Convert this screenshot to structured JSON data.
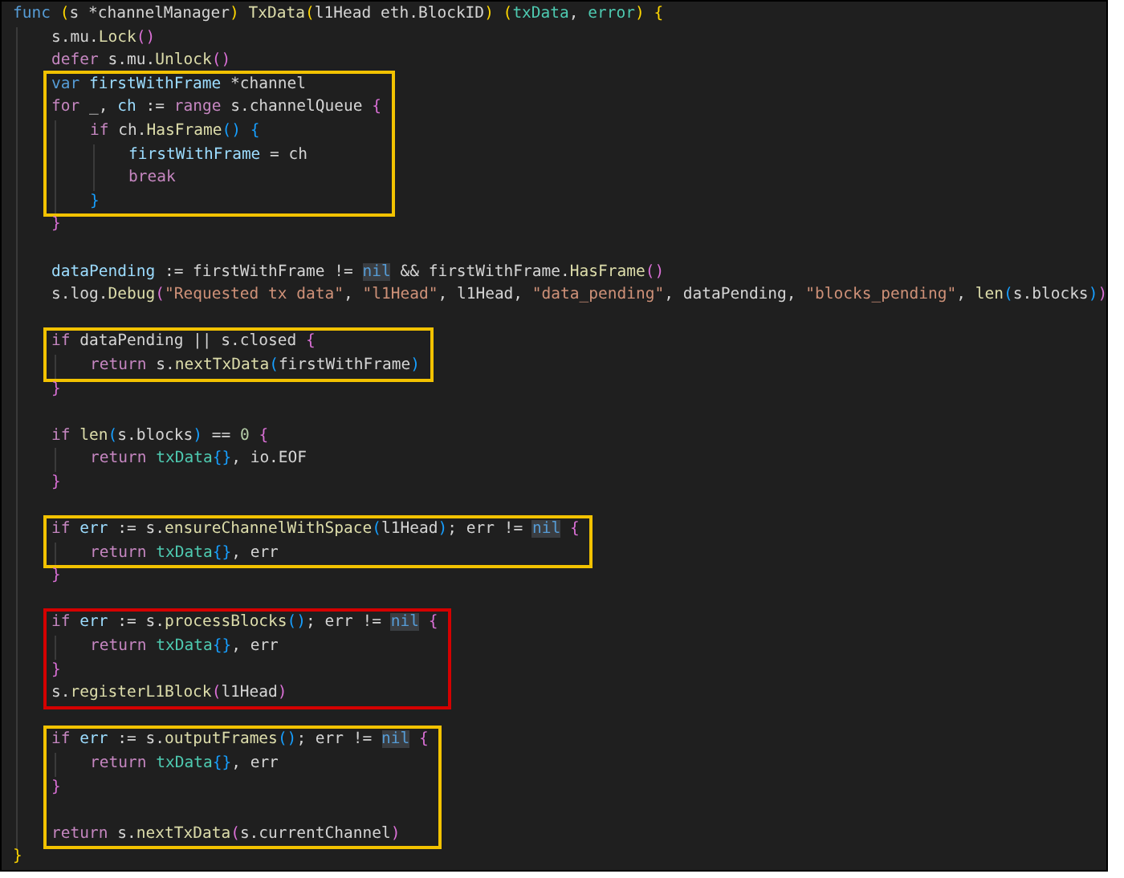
{
  "code": [
    {
      "kind": "line",
      "tokens": [
        {
          "kind": "kw",
          "text": "func "
        },
        {
          "kind": "b1",
          "text": "("
        },
        {
          "kind": "plain",
          "text": "s *channelManager"
        },
        {
          "kind": "b1",
          "text": ") "
        },
        {
          "kind": "fn",
          "text": "TxData"
        },
        {
          "kind": "b1",
          "text": "("
        },
        {
          "kind": "plain",
          "text": "l1Head eth.BlockID"
        },
        {
          "kind": "b1",
          "text": ") ("
        },
        {
          "kind": "type",
          "text": "txData"
        },
        {
          "kind": "plain",
          "text": ", "
        },
        {
          "kind": "type",
          "text": "error"
        },
        {
          "kind": "b1",
          "text": ") {"
        }
      ]
    },
    {
      "kind": "block",
      "children": [
        {
          "kind": "line",
          "tokens": [
            {
              "kind": "plain",
              "text": "s.mu."
            },
            {
              "kind": "fn",
              "text": "Lock"
            },
            {
              "kind": "b2",
              "text": "()"
            }
          ]
        },
        {
          "kind": "line",
          "tokens": [
            {
              "kind": "ctl",
              "text": "defer"
            },
            {
              "kind": "plain",
              "text": " s.mu."
            },
            {
              "kind": "fn",
              "text": "Unlock"
            },
            {
              "kind": "b2",
              "text": "()"
            }
          ]
        },
        {
          "kind": "box",
          "color": "#f2c200",
          "children": [
            {
              "kind": "line",
              "tokens": [
                {
                  "kind": "kw",
                  "text": "var "
                },
                {
                  "kind": "var",
                  "text": "firstWithFrame"
                },
                {
                  "kind": "plain",
                  "text": " *channel"
                }
              ]
            },
            {
              "kind": "line",
              "tokens": [
                {
                  "kind": "ctl",
                  "text": "for"
                },
                {
                  "kind": "plain",
                  "text": " _, "
                },
                {
                  "kind": "var",
                  "text": "ch"
                },
                {
                  "kind": "plain",
                  "text": " := "
                },
                {
                  "kind": "ctl",
                  "text": "range"
                },
                {
                  "kind": "plain",
                  "text": " s.channelQueue "
                },
                {
                  "kind": "b2",
                  "text": "{"
                }
              ]
            },
            {
              "kind": "block",
              "children": [
                {
                  "kind": "line",
                  "tokens": [
                    {
                      "kind": "ctl",
                      "text": "if"
                    },
                    {
                      "kind": "plain",
                      "text": " ch."
                    },
                    {
                      "kind": "fn",
                      "text": "HasFrame"
                    },
                    {
                      "kind": "b3",
                      "text": "() {"
                    }
                  ]
                },
                {
                  "kind": "block",
                  "children": [
                    {
                      "kind": "line",
                      "tokens": [
                        {
                          "kind": "var",
                          "text": "firstWithFrame"
                        },
                        {
                          "kind": "plain",
                          "text": " = ch"
                        }
                      ]
                    },
                    {
                      "kind": "line",
                      "tokens": [
                        {
                          "kind": "ctl",
                          "text": "break"
                        }
                      ]
                    }
                  ]
                },
                {
                  "kind": "line",
                  "tokens": [
                    {
                      "kind": "b3",
                      "text": "}"
                    }
                  ]
                }
              ]
            }
          ]
        },
        {
          "kind": "line",
          "tokens": [
            {
              "kind": "b2",
              "text": "}"
            }
          ]
        },
        {
          "kind": "blank"
        },
        {
          "kind": "line",
          "tokens": [
            {
              "kind": "var",
              "text": "dataPending"
            },
            {
              "kind": "plain",
              "text": " := firstWithFrame != "
            },
            {
              "kind": "nil",
              "text": "nil"
            },
            {
              "kind": "plain",
              "text": " && firstWithFrame."
            },
            {
              "kind": "fn",
              "text": "HasFrame"
            },
            {
              "kind": "b2",
              "text": "()"
            }
          ]
        },
        {
          "kind": "line",
          "tokens": [
            {
              "kind": "plain",
              "text": "s.log."
            },
            {
              "kind": "fn",
              "text": "Debug"
            },
            {
              "kind": "b2",
              "text": "("
            },
            {
              "kind": "str",
              "text": "\"Requested tx data\""
            },
            {
              "kind": "plain",
              "text": ", "
            },
            {
              "kind": "str",
              "text": "\"l1Head\""
            },
            {
              "kind": "plain",
              "text": ", l1Head, "
            },
            {
              "kind": "str",
              "text": "\"data_pending\""
            },
            {
              "kind": "plain",
              "text": ", dataPending, "
            },
            {
              "kind": "str",
              "text": "\"blocks_pending\""
            },
            {
              "kind": "plain",
              "text": ", "
            },
            {
              "kind": "fn",
              "text": "len"
            },
            {
              "kind": "b3",
              "text": "("
            },
            {
              "kind": "plain",
              "text": "s.blocks"
            },
            {
              "kind": "b3",
              "text": ")"
            },
            {
              "kind": "b2",
              "text": ")"
            }
          ]
        },
        {
          "kind": "blank"
        },
        {
          "kind": "box",
          "color": "#f2c200",
          "children": [
            {
              "kind": "line",
              "tokens": [
                {
                  "kind": "ctl",
                  "text": "if"
                },
                {
                  "kind": "plain",
                  "text": " dataPending || s.closed "
                },
                {
                  "kind": "b2",
                  "text": "{"
                }
              ]
            },
            {
              "kind": "block",
              "children": [
                {
                  "kind": "line",
                  "tokens": [
                    {
                      "kind": "ctl",
                      "text": "return"
                    },
                    {
                      "kind": "plain",
                      "text": " s."
                    },
                    {
                      "kind": "fn",
                      "text": "nextTxData"
                    },
                    {
                      "kind": "b3",
                      "text": "("
                    },
                    {
                      "kind": "plain",
                      "text": "firstWithFrame"
                    },
                    {
                      "kind": "b3",
                      "text": ")"
                    }
                  ]
                }
              ]
            }
          ]
        },
        {
          "kind": "line",
          "tokens": [
            {
              "kind": "b2",
              "text": "}"
            }
          ]
        },
        {
          "kind": "blank"
        },
        {
          "kind": "line",
          "tokens": [
            {
              "kind": "ctl",
              "text": "if "
            },
            {
              "kind": "fn",
              "text": "len"
            },
            {
              "kind": "b3",
              "text": "("
            },
            {
              "kind": "plain",
              "text": "s.blocks"
            },
            {
              "kind": "b3",
              "text": ")"
            },
            {
              "kind": "plain",
              "text": " == "
            },
            {
              "kind": "num",
              "text": "0 "
            },
            {
              "kind": "b2",
              "text": "{"
            }
          ]
        },
        {
          "kind": "block",
          "children": [
            {
              "kind": "line",
              "tokens": [
                {
                  "kind": "ctl",
                  "text": "return "
                },
                {
                  "kind": "type",
                  "text": "txData"
                },
                {
                  "kind": "b3",
                  "text": "{}"
                },
                {
                  "kind": "plain",
                  "text": ", io.EOF"
                }
              ]
            }
          ]
        },
        {
          "kind": "line",
          "tokens": [
            {
              "kind": "b2",
              "text": "}"
            }
          ]
        },
        {
          "kind": "blank"
        },
        {
          "kind": "box",
          "color": "#f2c200",
          "children": [
            {
              "kind": "line",
              "tokens": [
                {
                  "kind": "ctl",
                  "text": "if "
                },
                {
                  "kind": "var",
                  "text": "err"
                },
                {
                  "kind": "plain",
                  "text": " := s."
                },
                {
                  "kind": "fn",
                  "text": "ensureChannelWithSpace"
                },
                {
                  "kind": "b3",
                  "text": "("
                },
                {
                  "kind": "plain",
                  "text": "l1Head"
                },
                {
                  "kind": "b3",
                  "text": ")"
                },
                {
                  "kind": "plain",
                  "text": "; err != "
                },
                {
                  "kind": "nil",
                  "text": "nil"
                },
                {
                  "kind": "b2",
                  "text": " {"
                }
              ]
            },
            {
              "kind": "block",
              "children": [
                {
                  "kind": "line",
                  "tokens": [
                    {
                      "kind": "ctl",
                      "text": "return "
                    },
                    {
                      "kind": "type",
                      "text": "txData"
                    },
                    {
                      "kind": "b3",
                      "text": "{}"
                    },
                    {
                      "kind": "plain",
                      "text": ", err"
                    }
                  ]
                }
              ]
            }
          ]
        },
        {
          "kind": "line",
          "tokens": [
            {
              "kind": "b2",
              "text": "}"
            }
          ]
        },
        {
          "kind": "blank"
        },
        {
          "kind": "box",
          "color": "#d40000",
          "children": [
            {
              "kind": "line",
              "tokens": [
                {
                  "kind": "ctl",
                  "text": "if "
                },
                {
                  "kind": "var",
                  "text": "err"
                },
                {
                  "kind": "plain",
                  "text": " := s."
                },
                {
                  "kind": "fn",
                  "text": "processBlocks"
                },
                {
                  "kind": "b3",
                  "text": "()"
                },
                {
                  "kind": "plain",
                  "text": "; err != "
                },
                {
                  "kind": "nil",
                  "text": "nil"
                },
                {
                  "kind": "b2",
                  "text": " {"
                }
              ]
            },
            {
              "kind": "block",
              "children": [
                {
                  "kind": "line",
                  "tokens": [
                    {
                      "kind": "ctl",
                      "text": "return "
                    },
                    {
                      "kind": "type",
                      "text": "txData"
                    },
                    {
                      "kind": "b3",
                      "text": "{}"
                    },
                    {
                      "kind": "plain",
                      "text": ", err"
                    }
                  ]
                }
              ]
            },
            {
              "kind": "line",
              "tokens": [
                {
                  "kind": "b2",
                  "text": "}"
                }
              ]
            },
            {
              "kind": "line",
              "tokens": [
                {
                  "kind": "plain",
                  "text": "s."
                },
                {
                  "kind": "fn",
                  "text": "registerL1Block"
                },
                {
                  "kind": "b2",
                  "text": "("
                },
                {
                  "kind": "plain",
                  "text": "l1Head"
                },
                {
                  "kind": "b2",
                  "text": ")"
                }
              ]
            }
          ]
        },
        {
          "kind": "blank"
        },
        {
          "kind": "box",
          "color": "#f2c200",
          "children": [
            {
              "kind": "line",
              "tokens": [
                {
                  "kind": "ctl",
                  "text": "if "
                },
                {
                  "kind": "var",
                  "text": "err"
                },
                {
                  "kind": "plain",
                  "text": " := s."
                },
                {
                  "kind": "fn",
                  "text": "outputFrames"
                },
                {
                  "kind": "b3",
                  "text": "()"
                },
                {
                  "kind": "plain",
                  "text": "; err != "
                },
                {
                  "kind": "nil",
                  "text": "nil"
                },
                {
                  "kind": "b2",
                  "text": " {"
                }
              ]
            },
            {
              "kind": "block",
              "children": [
                {
                  "kind": "line",
                  "tokens": [
                    {
                      "kind": "ctl",
                      "text": "return "
                    },
                    {
                      "kind": "type",
                      "text": "txData"
                    },
                    {
                      "kind": "b3",
                      "text": "{}"
                    },
                    {
                      "kind": "plain",
                      "text": ", err"
                    }
                  ]
                }
              ]
            },
            {
              "kind": "line",
              "tokens": [
                {
                  "kind": "b2",
                  "text": "}"
                }
              ]
            },
            {
              "kind": "blank"
            },
            {
              "kind": "line",
              "tokens": [
                {
                  "kind": "ctl",
                  "text": "return"
                },
                {
                  "kind": "plain",
                  "text": " s."
                },
                {
                  "kind": "fn",
                  "text": "nextTxData"
                },
                {
                  "kind": "b2",
                  "text": "("
                },
                {
                  "kind": "plain",
                  "text": "s.currentChannel"
                },
                {
                  "kind": "b2",
                  "text": ")"
                }
              ]
            }
          ]
        }
      ]
    },
    {
      "kind": "line",
      "tokens": [
        {
          "kind": "b1",
          "text": "}"
        }
      ]
    }
  ]
}
